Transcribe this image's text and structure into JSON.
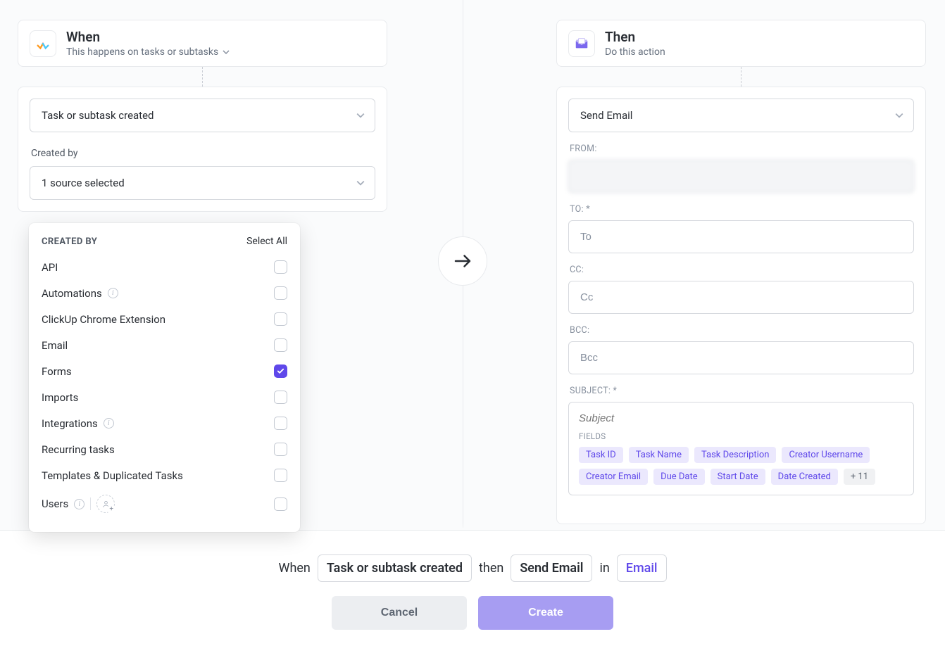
{
  "when": {
    "title": "When",
    "subtitle": "This happens on tasks or subtasks",
    "trigger": "Task or subtask created",
    "created_by_label": "Created by",
    "created_by_value": "1 source selected"
  },
  "then": {
    "title": "Then",
    "subtitle": "Do this action",
    "action": "Send Email",
    "from_label": "FROM:",
    "from_value": "",
    "to_label": "TO: *",
    "to_placeholder": "To",
    "cc_label": "CC:",
    "cc_placeholder": "Cc",
    "bcc_label": "BCC:",
    "bcc_placeholder": "Bcc",
    "subject_label": "SUBJECT: *",
    "subject_placeholder": "Subject",
    "fields_label": "FIELDS",
    "field_chips": [
      "Task ID",
      "Task Name",
      "Task Description",
      "Creator Username",
      "Creator Email",
      "Due Date",
      "Start Date",
      "Date Created"
    ],
    "more_chip": "+ 11"
  },
  "popover": {
    "title": "CREATED BY",
    "select_all": "Select All",
    "options": [
      {
        "label": "API",
        "checked": false
      },
      {
        "label": "Automations",
        "checked": false,
        "info": true
      },
      {
        "label": "ClickUp Chrome Extension",
        "checked": false
      },
      {
        "label": "Email",
        "checked": false
      },
      {
        "label": "Forms",
        "checked": true
      },
      {
        "label": "Imports",
        "checked": false
      },
      {
        "label": "Integrations",
        "checked": false,
        "info": true
      },
      {
        "label": "Recurring tasks",
        "checked": false
      },
      {
        "label": "Templates & Duplicated Tasks",
        "checked": false
      },
      {
        "label": "Users",
        "checked": false,
        "info": true,
        "users": true
      }
    ]
  },
  "footer": {
    "when_word": "When",
    "trigger": "Task or subtask created",
    "then_word": "then",
    "action": "Send Email",
    "in_word": "in",
    "scope": "Email",
    "cancel": "Cancel",
    "create": "Create"
  }
}
